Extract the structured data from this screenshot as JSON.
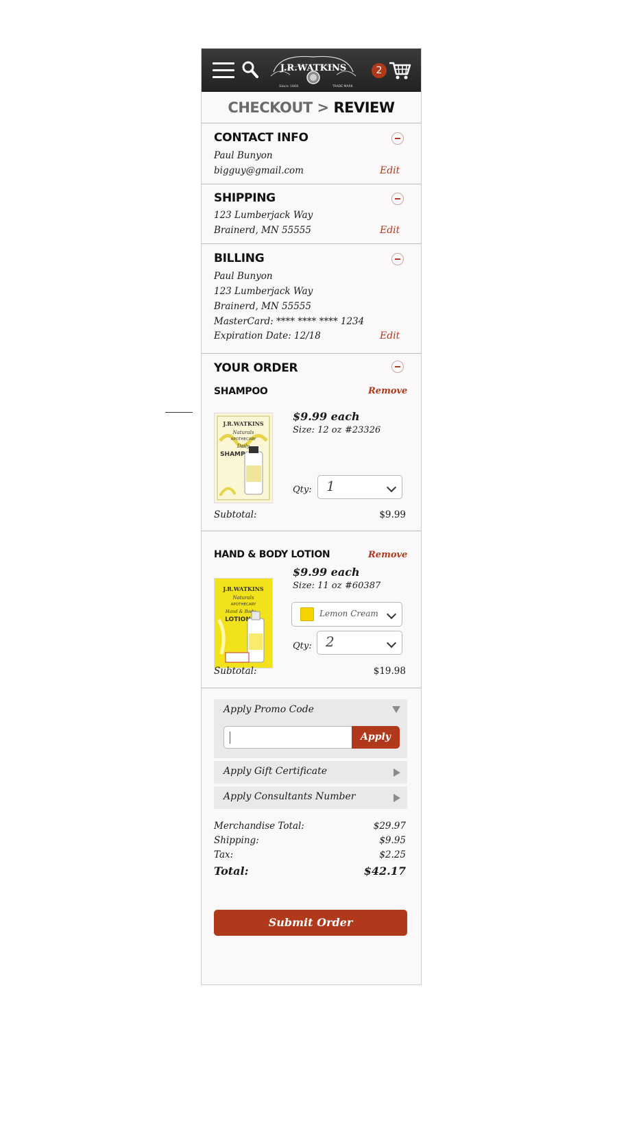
{
  "header": {
    "brand": "J.R. WATKINS",
    "brand_since": "Since 1868",
    "brand_tm": "TRADE MARK",
    "cart_count": "2",
    "icons": [
      "menu-icon",
      "search-icon",
      "cart-icon"
    ]
  },
  "title": {
    "step": "CHECKOUT",
    "sep": ">",
    "current": "REVIEW"
  },
  "contact": {
    "heading": "CONTACT INFO",
    "name": "Paul Bunyon",
    "email": "bigguy@gmail.com",
    "edit": "Edit"
  },
  "shipping": {
    "heading": "SHIPPING",
    "line1": "123 Lumberjack Way",
    "line2": "Brainerd, MN 55555",
    "edit": "Edit"
  },
  "billing": {
    "heading": "BILLING",
    "name": "Paul Bunyon",
    "line1": "123 Lumberjack Way",
    "line2": "Brainerd, MN 55555",
    "card": "MasterCard: **** **** **** 1234",
    "expiry": "Expiration Date: 12/18",
    "edit": "Edit"
  },
  "order": {
    "heading": "YOUR ORDER",
    "items": [
      {
        "name": "SHAMPOO",
        "remove": "Remove",
        "price": "$9.99 each",
        "size": "Size: 12 oz",
        "sku": "#23326",
        "qty_label": "Qty:",
        "qty": "1",
        "subtotal_label": "Subtotal:",
        "subtotal": "$9.99",
        "image_text": [
          "J.R.WATKINS",
          "Naturals",
          "APOTHECARY",
          "Daily",
          "SHAMPOO"
        ]
      },
      {
        "name": "HAND & BODY LOTION",
        "remove": "Remove",
        "price": "$9.99 each",
        "size": "Size: 11 oz",
        "sku": "#60387",
        "variant": "Lemon Cream",
        "variant_color": "#f5d400",
        "qty_label": "Qty:",
        "qty": "2",
        "subtotal_label": "Subtotal:",
        "subtotal": "$19.98",
        "image_text": [
          "J.R.WATKINS",
          "Naturals",
          "APOTHECARY",
          "Hand & Body",
          "LOTION"
        ]
      }
    ]
  },
  "promo": {
    "promo_label": "Apply Promo Code",
    "promo_value": "",
    "apply": "Apply",
    "gift_label": "Apply Gift Certificate",
    "consultant_label": "Apply Consultants Number"
  },
  "totals": {
    "merch_label": "Merchandise Total:",
    "merch": "$29.97",
    "shipping_label": "Shipping:",
    "shipping": "$9.95",
    "tax_label": "Tax:",
    "tax": "$2.25",
    "total_label": "Total:",
    "total": "$42.17"
  },
  "submit": "Submit Order",
  "colors": {
    "accent": "#b0391b",
    "header": "#2a2a2a",
    "panel": "#e9e9e9"
  }
}
